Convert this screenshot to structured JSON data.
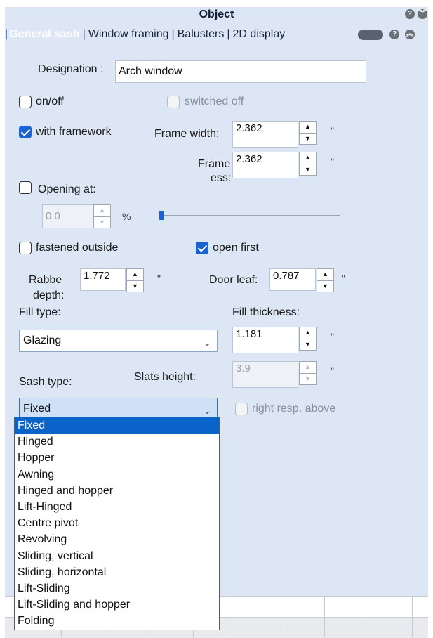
{
  "title": "Object",
  "tabs": [
    "General sash",
    "Window framing",
    "Balusters",
    "2D display"
  ],
  "designation": {
    "label": "Designation :",
    "value": "Arch window"
  },
  "on_off": {
    "label": "on/off",
    "checked": false
  },
  "switched_off": {
    "label": "switched off",
    "checked": false
  },
  "with_framework": {
    "label": "with framework",
    "checked": true
  },
  "frame_width": {
    "label": "Frame width:",
    "value": "2.362",
    "unit": "\""
  },
  "frame_thickness": {
    "label_line1": "Frame",
    "label_line2": "ess:",
    "value": "2.362",
    "unit": "\""
  },
  "opening_at": {
    "label": "Opening at:",
    "checked": false,
    "value": "0.0",
    "unit": "%",
    "slider_fraction": 0.0
  },
  "fastened_outside": {
    "label": "fastened outside",
    "checked": false
  },
  "open_first": {
    "label": "open first",
    "checked": true
  },
  "rabbet_depth": {
    "label_line1": "Rabbe",
    "label_line2": "depth:",
    "value": "1.772",
    "unit": "\""
  },
  "door_leaf": {
    "label": "Door leaf:",
    "value": "0.787",
    "unit": "\""
  },
  "fill_type": {
    "label": "Fill type:",
    "value": "Glazing"
  },
  "fill_thickness": {
    "label": "Fill thickness:",
    "value": "1.181",
    "unit": "\""
  },
  "slats_height": {
    "label": "Slats height:",
    "value": "3.9",
    "unit": "\""
  },
  "sash_type": {
    "label": "Sash type:",
    "value": "Fixed",
    "options": [
      "Fixed",
      "Hinged",
      "Hopper",
      "Awning",
      "Hinged and hopper",
      "Lift-Hinged",
      "Centre pivot",
      "Revolving",
      "Sliding, vertical",
      "Sliding, horizontal",
      "Lift-Sliding",
      "Lift-Sliding and hopper",
      "Folding"
    ]
  },
  "right_resp_above": {
    "label": "right resp. above",
    "checked": false
  },
  "colors": {
    "panel_bg": "#dce6f4",
    "accent": "#1a63d2",
    "selected": "#0a63c9"
  }
}
